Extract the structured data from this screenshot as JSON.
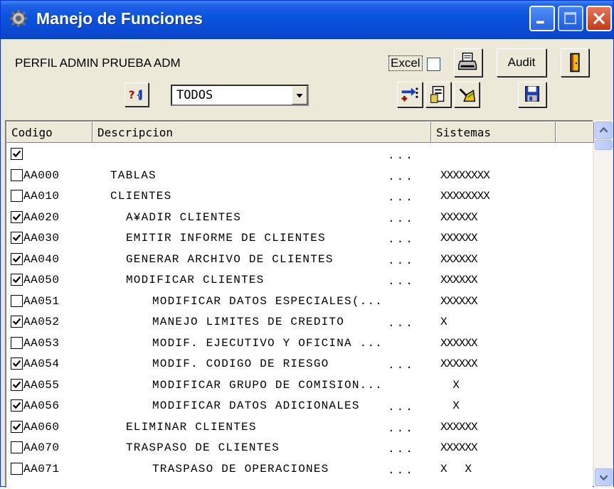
{
  "window": {
    "title": "Manejo de Funciones"
  },
  "toolbar": {
    "perfil_text": "PERFIL ADMIN PRUEBA  ADM",
    "excel_label": "Excel",
    "audit_label": "Audit",
    "filter_value": "TODOS"
  },
  "grid": {
    "headers": {
      "codigo": "Codigo",
      "descripcion": "Descripcion",
      "sistemas": "Sistemas"
    },
    "rows": [
      {
        "checked": true,
        "code": "",
        "desc": "",
        "dots": "...",
        "sist": ""
      },
      {
        "checked": false,
        "code": "AA000",
        "desc": "TABLAS",
        "dots": "...",
        "sist": "XXXXXXXX"
      },
      {
        "checked": false,
        "code": "AA010",
        "desc": "CLIENTES",
        "dots": "...",
        "sist": "XXXXXXXX"
      },
      {
        "checked": true,
        "code": "AA020",
        "desc": "A¥ADIR CLIENTES",
        "dots": "...",
        "sist": "XXXXXX"
      },
      {
        "checked": true,
        "code": "AA030",
        "desc": "EMITIR INFORME DE CLIENTES",
        "dots": "...",
        "sist": "XXXXXX"
      },
      {
        "checked": true,
        "code": "AA040",
        "desc": "GENERAR ARCHIVO DE CLIENTES",
        "dots": "...",
        "sist": "XXXXXX"
      },
      {
        "checked": true,
        "code": "AA050",
        "desc": "MODIFICAR CLIENTES",
        "dots": "...",
        "sist": "XXXXXX"
      },
      {
        "checked": false,
        "code": "AA051",
        "desc": "MODIFICAR DATOS ESPECIALES(...",
        "dots": "",
        "sist": "XXXXXX"
      },
      {
        "checked": true,
        "code": "AA052",
        "desc": "MANEJO LIMITES DE CREDITO",
        "dots": "...",
        "sist": "X"
      },
      {
        "checked": false,
        "code": "AA053",
        "desc": "MODIF. EJECUTIVO Y OFICINA ...",
        "dots": "",
        "sist": "XXXXXX"
      },
      {
        "checked": true,
        "code": "AA054",
        "desc": "MODIF. CODIGO DE RIESGO",
        "dots": "...",
        "sist": "XXXXXX"
      },
      {
        "checked": true,
        "code": "AA055",
        "desc": "MODIFICAR GRUPO DE COMISION...",
        "dots": "",
        "sist": "  X"
      },
      {
        "checked": true,
        "code": "AA056",
        "desc": "MODIFICAR DATOS ADICIONALES",
        "dots": "...",
        "sist": "  X"
      },
      {
        "checked": true,
        "code": "AA060",
        "desc": "ELIMINAR CLIENTES",
        "dots": "...",
        "sist": "XXXXXX"
      },
      {
        "checked": false,
        "code": "AA070",
        "desc": "TRASPASO DE CLIENTES",
        "dots": "...",
        "sist": "XXXXXX"
      },
      {
        "checked": false,
        "code": "AA071",
        "desc": "TRASPASO DE OPERACIONES",
        "dots": "...",
        "sist": "X   X"
      }
    ]
  },
  "colors": {
    "titlebar": "#0a55df",
    "face": "#ece9d8",
    "close": "#c23a17"
  },
  "icons": [
    "gear-icon",
    "minimize-icon",
    "maximize-icon",
    "close-icon",
    "printer-icon",
    "exit-door-icon",
    "help-icon",
    "transfer-icon",
    "document-icon",
    "broom-icon",
    "save-disk-icon"
  ]
}
